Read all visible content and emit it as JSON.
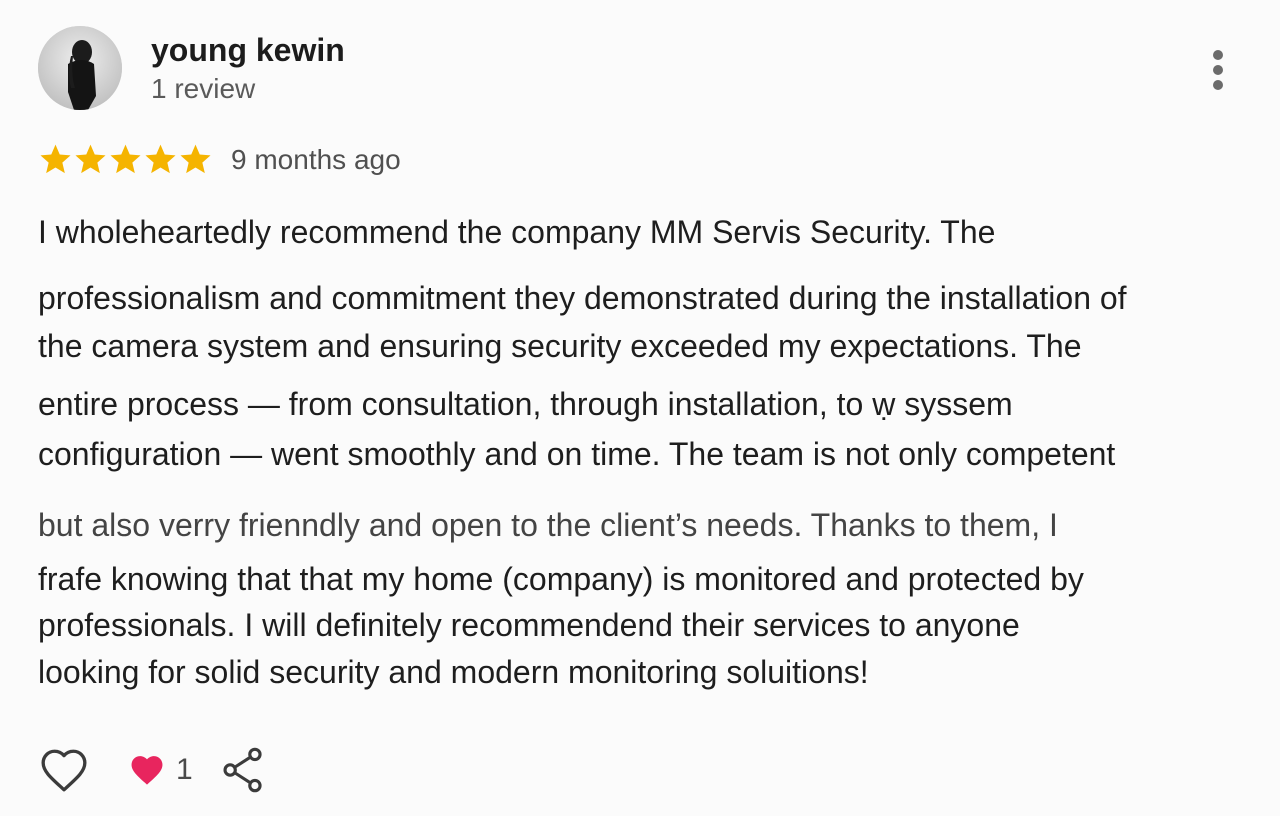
{
  "reviewer": {
    "name": "young kewin",
    "review_count": "1 review",
    "avatar_icon": "person-silhouette-avatar"
  },
  "review": {
    "rating": 5,
    "max_rating": 5,
    "star_color": "#f5b400",
    "time_ago": "9 months ago",
    "lines": [
      "I wholeheartedly recommend the company MM Servis Security. The",
      "professionalism and commitment they demonstrated during the installation of",
      "the camera system and ensuring security exceeded my expectations. The",
      "entire process  — from consultation, through installation, to  ẉ syssem",
      "configuration — went smoothly and on time. The team is not only competent",
      "but also verry frienndly and  open to  the client’s needs. Thanks to them, I",
      "frafe knowing  that that my home  (company) is monitored and protected by",
      "professionals. I will definitely recommendend their services to anyone",
      "looking for solid security and modern monitoring soluitions!"
    ]
  },
  "actions": {
    "like_icon": "heart-outline-icon",
    "reaction_icon": "heart-filled-icon",
    "reaction_color": "#e8255e",
    "reaction_count": "1",
    "share_icon": "share-icon",
    "more_icon": "more-vert-icon"
  }
}
